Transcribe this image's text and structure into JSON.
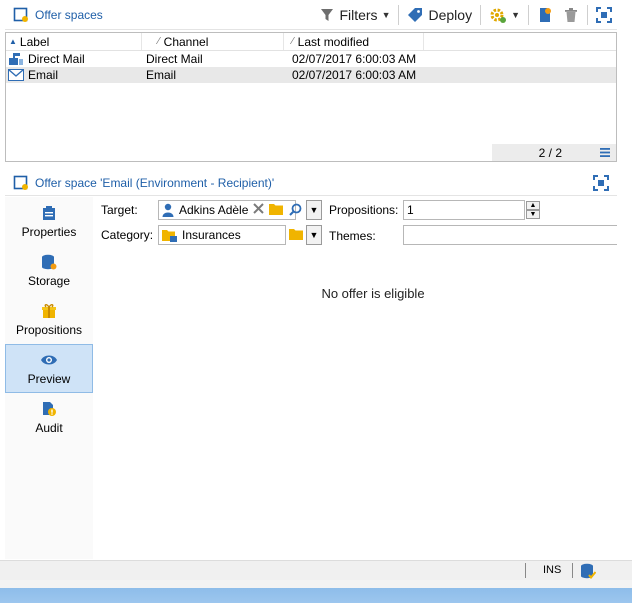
{
  "toolbar": {
    "title": "Offer spaces",
    "filters_label": "Filters",
    "deploy_label": "Deploy"
  },
  "list": {
    "columns": [
      "Label",
      "Channel",
      "Last modified"
    ],
    "rows": [
      {
        "label": "Direct Mail",
        "channel": "Direct Mail",
        "modified": "02/07/2017 6:00:03 AM"
      },
      {
        "label": "Email",
        "channel": "Email",
        "modified": "02/07/2017 6:00:03 AM"
      }
    ],
    "count": "2 / 2"
  },
  "detail": {
    "title": "Offer space 'Email (Environment - Recipient)'",
    "nav": [
      "Properties",
      "Storage",
      "Propositions",
      "Preview",
      "Audit"
    ],
    "active_nav": "Preview",
    "target_label": "Target:",
    "target_value": "Adkins Adèle",
    "category_label": "Category:",
    "category_value": "Insurances",
    "propositions_label": "Propositions:",
    "propositions_value": "1",
    "themes_label": "Themes:",
    "themes_value": "",
    "empty_message": "No offer is eligible"
  },
  "statusbar": {
    "mode": "INS"
  },
  "colors": {
    "accent": "#1f5fa8",
    "selected_nav": "#cfe3f7",
    "folder": "#f0b400",
    "bottom_bar": "#9cc6ee"
  }
}
